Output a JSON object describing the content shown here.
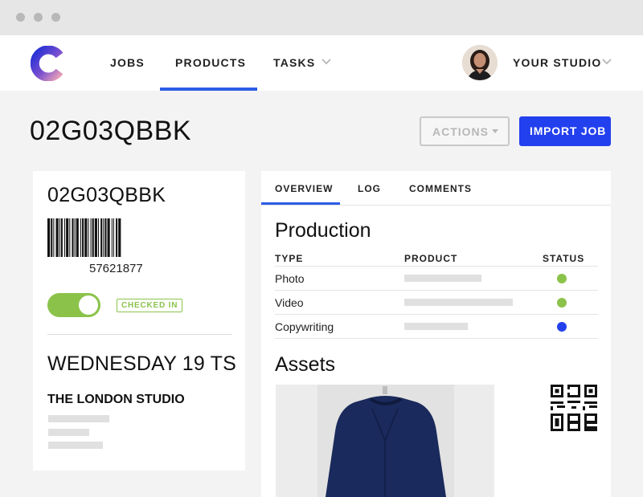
{
  "window": {
    "controls": [
      "close",
      "minimize",
      "maximize"
    ]
  },
  "nav": {
    "logo": "brand-logo",
    "items": [
      {
        "label": "JOBS"
      },
      {
        "label": "PRODUCTS",
        "active": true
      },
      {
        "label": "TASKS",
        "has_dropdown": true
      }
    ],
    "studio_label": "YOUR STUDIO"
  },
  "header": {
    "title": "02G03QBBK",
    "actions_label": "ACTIONS",
    "import_label": "IMPORT JOB"
  },
  "job_card": {
    "code": "02G03QBBK",
    "barcode_number": "57621877",
    "checked_in": true,
    "checked_in_label": "CHECKED IN",
    "date": "WEDNESDAY 19 TS",
    "studio": "THE LONDON STUDIO"
  },
  "details": {
    "tabs": [
      {
        "label": "OVERVIEW",
        "active": true
      },
      {
        "label": "LOG"
      },
      {
        "label": "COMMENTS"
      }
    ],
    "production": {
      "title": "Production",
      "columns": [
        "TYPE",
        "PRODUCT",
        "STATUS"
      ],
      "rows": [
        {
          "type": "Photo",
          "status_color": "#8bc34a"
        },
        {
          "type": "Video",
          "status_color": "#8bc34a"
        },
        {
          "type": "Copywriting",
          "status_color": "#2340ee"
        }
      ]
    },
    "assets": {
      "title": "Assets"
    }
  },
  "colors": {
    "accent": "#2b5ce6",
    "primary_button": "#2340ee",
    "success": "#8bc34a"
  }
}
